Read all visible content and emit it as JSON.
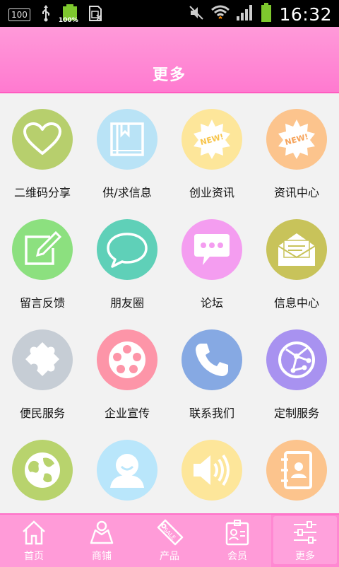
{
  "status_bar": {
    "badge_100": "100",
    "battery_small_text": "100%",
    "time": "16:32"
  },
  "header": {
    "title": "更多"
  },
  "menu": [
    {
      "label": "二维码分享",
      "icon": "heart-icon",
      "color": "#b7cf6d"
    },
    {
      "label": "供/求信息",
      "icon": "book-icon",
      "color": "#b9e3f6"
    },
    {
      "label": "创业资讯",
      "icon": "new-badge-icon",
      "color": "#fde69a"
    },
    {
      "label": "资讯中心",
      "icon": "new-badge-icon",
      "color": "#fcc48d"
    },
    {
      "label": "留言反馈",
      "icon": "edit-icon",
      "color": "#8ce07f"
    },
    {
      "label": "朋友圈",
      "icon": "chat-bubble-icon",
      "color": "#5fd0b8"
    },
    {
      "label": "论坛",
      "icon": "message-icon",
      "color": "#f49df0"
    },
    {
      "label": "信息中心",
      "icon": "envelope-icon",
      "color": "#c8c35a"
    },
    {
      "label": "便民服务",
      "icon": "puzzle-icon",
      "color": "#c6cdd5"
    },
    {
      "label": "企业宣传",
      "icon": "film-reel-icon",
      "color": "#fd95a8"
    },
    {
      "label": "联系我们",
      "icon": "phone-icon",
      "color": "#86a9e3"
    },
    {
      "label": "定制服务",
      "icon": "globe-network-icon",
      "color": "#a892f0"
    },
    {
      "label": "",
      "icon": "world-icon",
      "color": "#b8d36d"
    },
    {
      "label": "",
      "icon": "user-face-icon",
      "color": "#b9e6fb"
    },
    {
      "label": "",
      "icon": "speaker-icon",
      "color": "#fde69a"
    },
    {
      "label": "",
      "icon": "contacts-book-icon",
      "color": "#fcc48d"
    }
  ],
  "tabbar": [
    {
      "label": "首页",
      "icon": "home-icon"
    },
    {
      "label": "商铺",
      "icon": "shop-icon"
    },
    {
      "label": "产品",
      "icon": "sale-tag-icon"
    },
    {
      "label": "会员",
      "icon": "member-card-icon"
    },
    {
      "label": "更多",
      "icon": "settings-sliders-icon"
    }
  ]
}
